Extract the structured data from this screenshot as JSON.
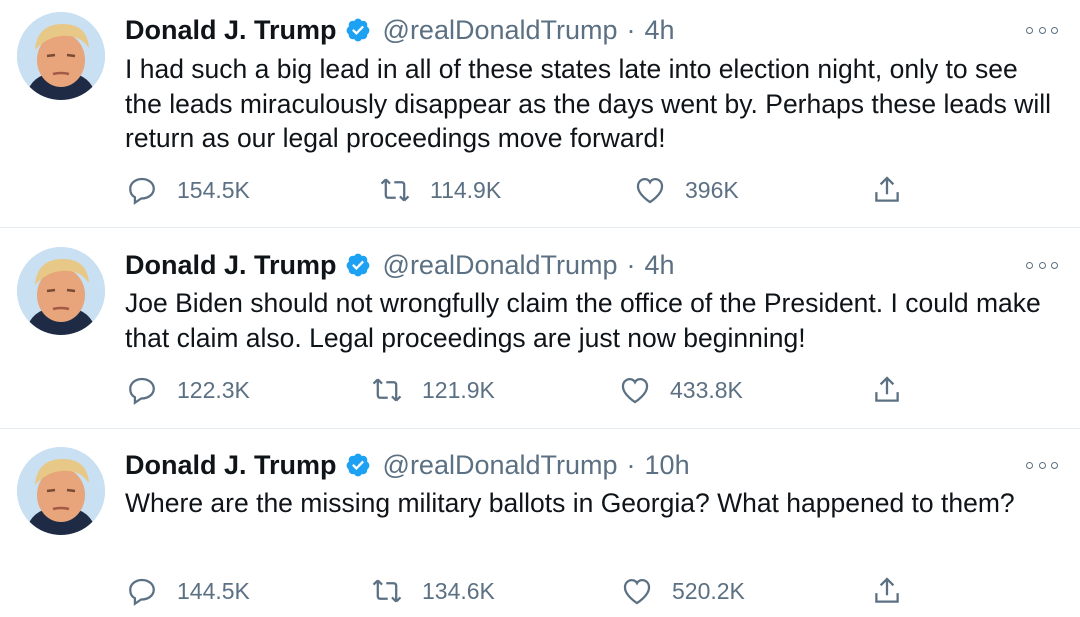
{
  "author": {
    "name": "Donald J. Trump",
    "handle": "@realDonaldTrump"
  },
  "colors": {
    "icon": "#5b7083",
    "text": "#0f1419",
    "verified": "#1da1f2",
    "divider": "#e6ecf0"
  },
  "tweets": [
    {
      "time": "4h",
      "text": "I had such a big lead in all of these states late into election night, only to see the leads miraculously disappear as the days went by. Perhaps these leads will return as our legal proceedings move forward!",
      "replies": "154.5K",
      "retweets": "114.9K",
      "likes": "396K"
    },
    {
      "time": "4h",
      "text": "Joe Biden should not wrongfully claim the office of the President. I could make that claim also. Legal proceedings are just now beginning!",
      "replies": "122.3K",
      "retweets": "121.9K",
      "likes": "433.8K"
    },
    {
      "time": "10h",
      "text": "Where are the missing military ballots in Georgia? What happened to them?",
      "replies": "144.5K",
      "retweets": "134.6K",
      "likes": "520.2K"
    }
  ],
  "icons": {
    "reply": "reply-icon",
    "retweet": "retweet-icon",
    "like": "heart-icon",
    "share": "share-icon",
    "verified": "verified-badge-icon",
    "more": "more-icon"
  }
}
